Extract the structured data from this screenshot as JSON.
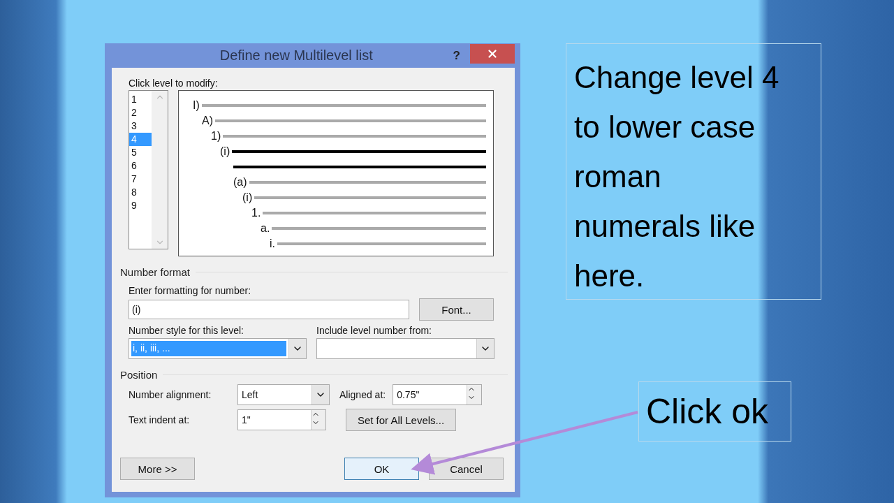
{
  "dialog": {
    "title": "Define new Multilevel list",
    "help": "?",
    "level_label": "Click level to modify:",
    "levels": [
      {
        "label": "1",
        "selected": false
      },
      {
        "label": "2",
        "selected": false
      },
      {
        "label": "3",
        "selected": false
      },
      {
        "label": "4",
        "selected": true
      },
      {
        "label": "5",
        "selected": false
      },
      {
        "label": "6",
        "selected": false
      },
      {
        "label": "7",
        "selected": false
      },
      {
        "label": "8",
        "selected": false
      },
      {
        "label": "9",
        "selected": false
      }
    ],
    "preview": [
      {
        "label": "I)",
        "selected": false
      },
      {
        "label": "A)",
        "selected": false
      },
      {
        "label": "1)",
        "selected": false
      },
      {
        "label": "(i)",
        "selected": true
      },
      {
        "label": "(a)",
        "selected": false
      },
      {
        "label": "(i)",
        "selected": false
      },
      {
        "label": "1.",
        "selected": false
      },
      {
        "label": "a.",
        "selected": false
      },
      {
        "label": "i.",
        "selected": false
      }
    ],
    "number_format": {
      "heading": "Number format",
      "format_label": "Enter formatting for number:",
      "format_value": "(i)",
      "font_button": "Font...",
      "style_label": "Number style for this level:",
      "style_value": "i, ii, iii, ...",
      "include_label": "Include level number from:"
    },
    "position": {
      "heading": "Position",
      "alignment_label": "Number alignment:",
      "alignment_value": "Left",
      "aligned_at_label": "Aligned at:",
      "aligned_at_value": "0.75\"",
      "indent_label": "Text indent at:",
      "indent_value": "1\"",
      "set_all_button": "Set for All Levels..."
    },
    "buttons": [
      {
        "label": "More >>",
        "kind": "more"
      },
      {
        "label": "OK",
        "kind": "default"
      },
      {
        "label": "Cancel",
        "kind": "normal"
      }
    ]
  },
  "callouts": [
    {
      "text": "Change level 4 to lower case roman numerals like here.",
      "kind": "note"
    },
    {
      "text": "Click ok",
      "kind": "pointer"
    }
  ]
}
